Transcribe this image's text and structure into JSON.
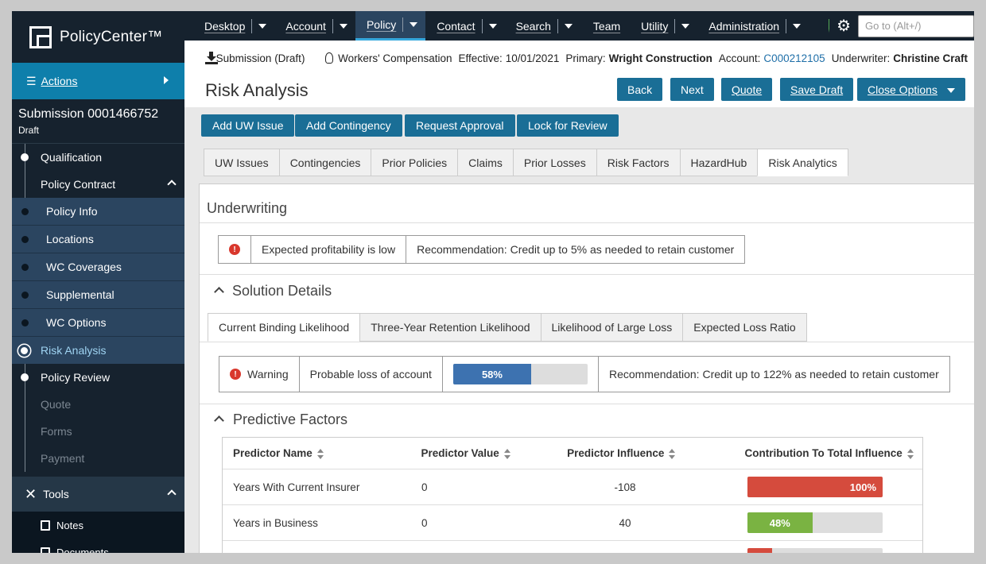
{
  "app": {
    "name": "PolicyCenter™"
  },
  "sidebar": {
    "actions_label": "Actions",
    "submission_title": "Submission 0001466752",
    "submission_status": "Draft",
    "nav": [
      {
        "label": "Qualification"
      },
      {
        "label": "Policy Contract"
      },
      {
        "label": "Policy Info"
      },
      {
        "label": "Locations"
      },
      {
        "label": "WC Coverages"
      },
      {
        "label": "Supplemental"
      },
      {
        "label": "WC Options"
      },
      {
        "label": "Risk Analysis"
      },
      {
        "label": "Policy Review"
      },
      {
        "label": "Quote"
      },
      {
        "label": "Forms"
      },
      {
        "label": "Payment"
      }
    ],
    "tools_label": "Tools",
    "tools": [
      {
        "label": "Notes"
      },
      {
        "label": "Documents"
      }
    ]
  },
  "topnav": {
    "items": [
      {
        "label": "Desktop"
      },
      {
        "label": "Account"
      },
      {
        "label": "Policy"
      },
      {
        "label": "Contact"
      },
      {
        "label": "Search"
      },
      {
        "label": "Team"
      },
      {
        "label": "Utility"
      },
      {
        "label": "Administration"
      }
    ],
    "goto_placeholder": "Go to (Alt+/)"
  },
  "infobar": {
    "submission": "Submission (Draft)",
    "line": "Workers' Compensation",
    "effective_label": "Effective:",
    "effective_value": "10/01/2021",
    "primary_label": "Primary:",
    "primary_value": "Wright Construction",
    "account_label": "Account:",
    "account_value": "C000212105",
    "underwriter_label": "Underwriter:",
    "underwriter_value": "Christine Craft"
  },
  "page": {
    "title": "Risk Analysis",
    "buttons": {
      "back": "Back",
      "next": "Next",
      "quote": "Quote",
      "save_draft": "Save Draft",
      "close_options": "Close Options"
    },
    "action_buttons": {
      "add_uw_issue": "Add UW Issue",
      "add_contingency": "Add Contingency",
      "request_approval": "Request Approval",
      "lock_for_review": "Lock for Review"
    },
    "tabs": [
      {
        "label": "UW Issues"
      },
      {
        "label": "Contingencies"
      },
      {
        "label": "Prior Policies"
      },
      {
        "label": "Claims"
      },
      {
        "label": "Prior Losses"
      },
      {
        "label": "Risk Factors"
      },
      {
        "label": "HazardHub"
      },
      {
        "label": "Risk Analytics"
      }
    ]
  },
  "underwriting": {
    "title": "Underwriting",
    "alert_text": "Expected profitability is low",
    "recommendation": "Recommendation: Credit up to 5% as needed to retain customer"
  },
  "solution": {
    "title": "Solution Details",
    "tabs": [
      {
        "label": "Current Binding Likelihood"
      },
      {
        "label": "Three-Year Retention Likelihood"
      },
      {
        "label": "Likelihood of Large Loss"
      },
      {
        "label": "Expected Loss Ratio"
      }
    ],
    "warning_label": "Warning",
    "message": "Probable loss of account",
    "progress_value": 0.58,
    "progress_text": "58%",
    "recommendation": "Recommendation: Credit up to 122% as needed to retain customer"
  },
  "predictive": {
    "title": "Predictive Factors",
    "columns": [
      "Predictor Name",
      "Predictor Value",
      "Predictor Influence",
      "Contribution To Total Influence"
    ],
    "rows": [
      {
        "name": "Years With Current Insurer",
        "value": "0",
        "influence": "-108",
        "contribution": 1.0,
        "contribution_text": "100%",
        "color": "#d54b3d"
      },
      {
        "name": "Years in Business",
        "value": "0",
        "influence": "40",
        "contribution": 0.48,
        "contribution_text": "48%",
        "color": "#7ab342"
      },
      {
        "name": "",
        "value": "",
        "influence": "",
        "contribution": 0.18,
        "contribution_text": "",
        "color": "#d54b3d"
      }
    ]
  }
}
